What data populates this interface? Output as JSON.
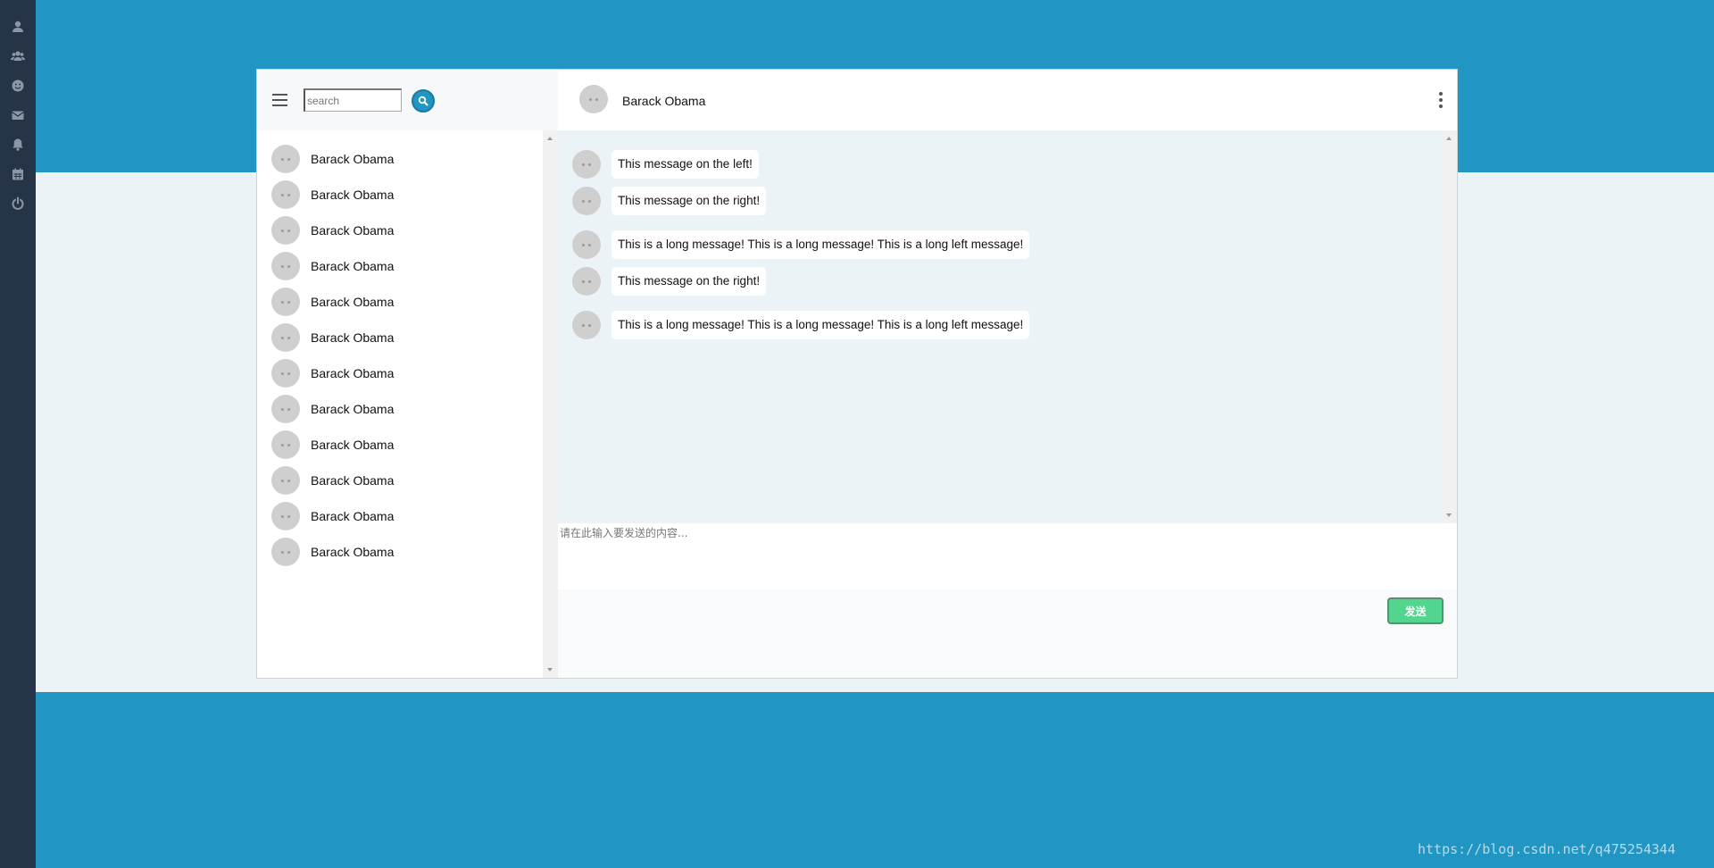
{
  "rail": {
    "icons": [
      "user-icon",
      "users-icon",
      "smile-icon",
      "envelope-icon",
      "bell-icon",
      "calendar-icon",
      "power-icon"
    ]
  },
  "contacts": {
    "search": {
      "placeholder": "search",
      "value": ""
    },
    "items": [
      {
        "name": "Barack Obama"
      },
      {
        "name": "Barack Obama"
      },
      {
        "name": "Barack Obama"
      },
      {
        "name": "Barack Obama"
      },
      {
        "name": "Barack Obama"
      },
      {
        "name": "Barack Obama"
      },
      {
        "name": "Barack Obama"
      },
      {
        "name": "Barack Obama"
      },
      {
        "name": "Barack Obama"
      },
      {
        "name": "Barack Obama"
      },
      {
        "name": "Barack Obama"
      },
      {
        "name": "Barack Obama"
      }
    ]
  },
  "chat": {
    "title": "Barack Obama",
    "messages": [
      {
        "text": "This message on the left!"
      },
      {
        "text": "This message on the right!"
      },
      {
        "text": "This is a long message! This is a long message! This is a long left message!"
      },
      {
        "text": "This message on the right!"
      },
      {
        "text": "This is a long message! This is a long message! This is a long left message!"
      }
    ],
    "composer": {
      "placeholder": "请在此输入要发送的内容...",
      "value": ""
    },
    "send_label": "发送"
  },
  "colors": {
    "accent": "#2196c3",
    "sidebar": "#263447",
    "send": "#52d68f",
    "chat_bg": "#ecf3f6"
  },
  "watermark": "https://blog.csdn.net/q475254344"
}
